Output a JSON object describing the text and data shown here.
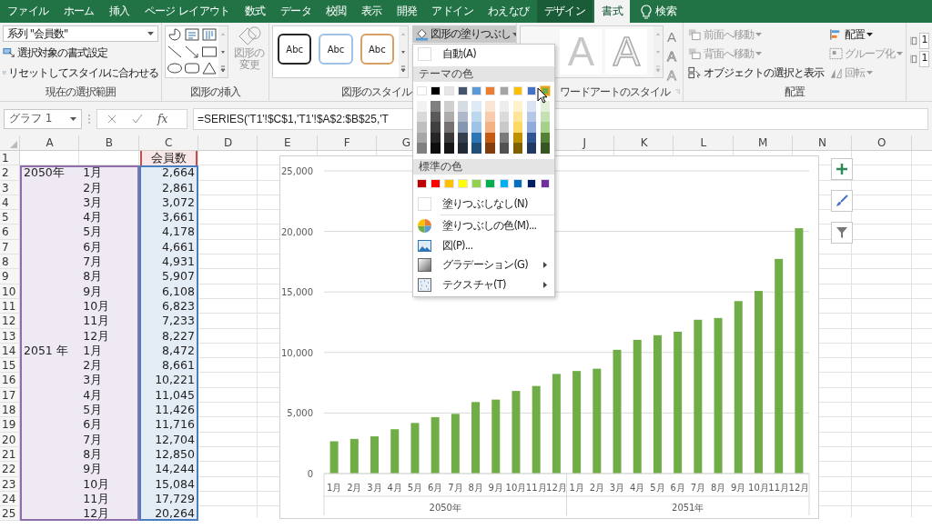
{
  "tabs": [
    {
      "label": "ファイル",
      "selected": false,
      "contextual": false
    },
    {
      "label": "ホーム",
      "selected": false,
      "contextual": false
    },
    {
      "label": "挿入",
      "selected": false,
      "contextual": false
    },
    {
      "label": "ページ レイアウト",
      "selected": false,
      "contextual": false
    },
    {
      "label": "数式",
      "selected": false,
      "contextual": false
    },
    {
      "label": "データ",
      "selected": false,
      "contextual": false
    },
    {
      "label": "校閲",
      "selected": false,
      "contextual": false
    },
    {
      "label": "表示",
      "selected": false,
      "contextual": false
    },
    {
      "label": "開発",
      "selected": false,
      "contextual": false
    },
    {
      "label": "アドイン",
      "selected": false,
      "contextual": false
    },
    {
      "label": "わえなび",
      "selected": false,
      "contextual": false
    },
    {
      "label": "デザイン",
      "selected": false,
      "contextual": true
    },
    {
      "label": "書式",
      "selected": true,
      "contextual": true
    }
  ],
  "tell_me": "検索",
  "ribbon": {
    "current_selection": {
      "label": "現在の選択範囲",
      "element": "系列 \"会員数\"",
      "buttons": [
        {
          "label": "選択対象の書式設定",
          "kind": "format"
        },
        {
          "label": "リセットしてスタイルに合わせる",
          "kind": "reset"
        }
      ]
    },
    "insert_shapes": {
      "label": "図形の挿入",
      "change_shape": {
        "label": "図形の変更",
        "disabled": true
      }
    },
    "shape_styles": {
      "label": "図形のスタイル",
      "presets": [
        {
          "text": "Abc",
          "color": "#262626"
        },
        {
          "text": "Abc",
          "color": "#9dc3e6"
        },
        {
          "text": "Abc",
          "color": "#d9a066"
        }
      ],
      "fill_button": {
        "label": "図形の塗りつぶし",
        "pressed": true
      }
    },
    "wordart_styles": {
      "label": "ワードアートのスタイル",
      "presets": [
        {
          "text": "A",
          "kind": "filled"
        },
        {
          "text": "A",
          "kind": "outline"
        }
      ],
      "buttons": [
        "A",
        "A",
        "A"
      ]
    },
    "arrange": {
      "label": "配置",
      "items": [
        {
          "label": "前面へ移動",
          "kind": "front",
          "disabled": true,
          "dropdown": true
        },
        {
          "label": "背面へ移動",
          "kind": "back",
          "disabled": true,
          "dropdown": true
        },
        {
          "label": "オブジェクトの選択と表示",
          "kind": "pane",
          "disabled": false,
          "dropdown": false
        },
        {
          "label": "配置",
          "kind": "align",
          "disabled": false,
          "dropdown": true
        },
        {
          "label": "グループ化",
          "kind": "group",
          "disabled": true,
          "dropdown": true
        },
        {
          "label": "回転",
          "kind": "rotate",
          "disabled": true,
          "dropdown": true
        }
      ]
    },
    "size": {
      "fields": [
        "1",
        "1"
      ]
    }
  },
  "formula_bar": {
    "name_box": "グラフ 1",
    "function_label": "fx",
    "formula": "=SERIES('T1'!$C$1,'T1'!$A$2:$B$25,'T"
  },
  "sheet": {
    "columns": [
      "A",
      "B",
      "C",
      "D",
      "E",
      "F",
      "G",
      "J",
      "K",
      "L",
      "M",
      "N",
      "O"
    ],
    "rows": [
      {
        "row": "1",
        "c": "会員数"
      },
      {
        "row": "2",
        "a": "2050年",
        "b": "1月",
        "c": "2,664"
      },
      {
        "row": "3",
        "b": "2月",
        "c": "2,861"
      },
      {
        "row": "4",
        "b": "3月",
        "c": "3,072"
      },
      {
        "row": "5",
        "b": "4月",
        "c": "3,661"
      },
      {
        "row": "6",
        "b": "5月",
        "c": "4,178"
      },
      {
        "row": "7",
        "b": "6月",
        "c": "4,661"
      },
      {
        "row": "8",
        "b": "7月",
        "c": "4,931"
      },
      {
        "row": "9",
        "b": "8月",
        "c": "5,907"
      },
      {
        "row": "10",
        "b": "9月",
        "c": "6,108"
      },
      {
        "row": "11",
        "b": "10月",
        "c": "6,823"
      },
      {
        "row": "12",
        "b": "11月",
        "c": "7,233"
      },
      {
        "row": "13",
        "b": "12月",
        "c": "8,227"
      },
      {
        "row": "14",
        "a": "2051 年",
        "b": "1月",
        "c": "8,472"
      },
      {
        "row": "15",
        "b": "2月",
        "c": "8,661"
      },
      {
        "row": "16",
        "b": "3月",
        "c": "10,221"
      },
      {
        "row": "17",
        "b": "4月",
        "c": "11,045"
      },
      {
        "row": "18",
        "b": "5月",
        "c": "11,426"
      },
      {
        "row": "19",
        "b": "6月",
        "c": "11,716"
      },
      {
        "row": "20",
        "b": "7月",
        "c": "12,704"
      },
      {
        "row": "21",
        "b": "8月",
        "c": "12,850"
      },
      {
        "row": "22",
        "b": "9月",
        "c": "14,244"
      },
      {
        "row": "23",
        "b": "10月",
        "c": "15,084"
      },
      {
        "row": "24",
        "b": "11月",
        "c": "17,729"
      },
      {
        "row": "25",
        "b": "12月",
        "c": "20,264"
      }
    ]
  },
  "chart": {
    "chart_data": {
      "type": "bar",
      "categories": [
        "1月",
        "2月",
        "3月",
        "4月",
        "5月",
        "6月",
        "7月",
        "8月",
        "9月",
        "10月",
        "11月",
        "12月",
        "1月",
        "2月",
        "3月",
        "4月",
        "5月",
        "6月",
        "7月",
        "8月",
        "9月",
        "10月",
        "11月",
        "12月"
      ],
      "grid": true,
      "series": [
        {
          "color": "#70ad47",
          "values": [
            2664,
            2861,
            3072,
            3661,
            4178,
            4661,
            4931,
            5907,
            6108,
            6823,
            7233,
            8227,
            8472,
            8661,
            10221,
            11045,
            11426,
            11716,
            12704,
            12850,
            14244,
            15084,
            17729,
            20264
          ]
        }
      ],
      "ylim": [
        0,
        25000
      ],
      "yticks": [
        {
          "value": 0,
          "label": "0"
        },
        {
          "value": 5000,
          "label": "5,000"
        },
        {
          "value": 10000,
          "label": "10,000"
        },
        {
          "value": 15000,
          "label": "15,000"
        },
        {
          "value": 20000,
          "label": "20,000"
        },
        {
          "value": 25000,
          "label": "25,000"
        }
      ]
    },
    "year_groups": [
      "2050年",
      "2051年"
    ]
  },
  "fill_menu": {
    "automatic": "自動(A)",
    "theme_header": "テーマの色",
    "theme_colors": [
      {
        "color": "#ffffff",
        "selected": false,
        "shades": [
          {
            "color": "#f2f2f2"
          },
          {
            "color": "#d9d9d9"
          },
          {
            "color": "#bfbfbf"
          },
          {
            "color": "#a6a6a6"
          },
          {
            "color": "#808080"
          }
        ]
      },
      {
        "color": "#000000",
        "selected": false,
        "shades": [
          {
            "color": "#808080"
          },
          {
            "color": "#595959"
          },
          {
            "color": "#404040"
          },
          {
            "color": "#262626"
          },
          {
            "color": "#0d0d0d"
          }
        ]
      },
      {
        "color": "#e7e6e6",
        "selected": false,
        "shades": [
          {
            "color": "#d0cece"
          },
          {
            "color": "#aeabab"
          },
          {
            "color": "#757171"
          },
          {
            "color": "#3a3838"
          },
          {
            "color": "#171616"
          }
        ]
      },
      {
        "color": "#44546a",
        "selected": false,
        "shades": [
          {
            "color": "#d6dce4"
          },
          {
            "color": "#adb9ca"
          },
          {
            "color": "#8496b0"
          },
          {
            "color": "#333f4f"
          },
          {
            "color": "#222a35"
          }
        ]
      },
      {
        "color": "#5b9bd5",
        "selected": false,
        "shades": [
          {
            "color": "#deebf6"
          },
          {
            "color": "#bdd7ee"
          },
          {
            "color": "#9dc3e6"
          },
          {
            "color": "#2e75b5"
          },
          {
            "color": "#1f4e79"
          }
        ]
      },
      {
        "color": "#ed7d31",
        "selected": false,
        "shades": [
          {
            "color": "#fbe5d5"
          },
          {
            "color": "#f7cbac"
          },
          {
            "color": "#f4b183"
          },
          {
            "color": "#c55a11"
          },
          {
            "color": "#833c0b"
          }
        ]
      },
      {
        "color": "#a5a5a5",
        "selected": false,
        "shades": [
          {
            "color": "#ededed"
          },
          {
            "color": "#dbdbdb"
          },
          {
            "color": "#c9c9c9"
          },
          {
            "color": "#7b7b7b"
          },
          {
            "color": "#525252"
          }
        ]
      },
      {
        "color": "#ffc000",
        "selected": false,
        "shades": [
          {
            "color": "#fff2cc"
          },
          {
            "color": "#fee599"
          },
          {
            "color": "#ffd965"
          },
          {
            "color": "#bf9000"
          },
          {
            "color": "#7f6000"
          }
        ]
      },
      {
        "color": "#4472c4",
        "selected": false,
        "shades": [
          {
            "color": "#dae3f3"
          },
          {
            "color": "#b4c7e7"
          },
          {
            "color": "#8faadc"
          },
          {
            "color": "#2f5496"
          },
          {
            "color": "#1f3864"
          }
        ]
      },
      {
        "color": "#70ad47",
        "selected": true,
        "shades": [
          {
            "color": "#e2efd9"
          },
          {
            "color": "#c5e0b3"
          },
          {
            "color": "#a8d08d"
          },
          {
            "color": "#538135"
          },
          {
            "color": "#375623"
          }
        ]
      }
    ],
    "standard_header": "標準の色",
    "standard_colors": [
      {
        "color": "#c00000"
      },
      {
        "color": "#ff0000"
      },
      {
        "color": "#ffc000"
      },
      {
        "color": "#ffff00"
      },
      {
        "color": "#92d050"
      },
      {
        "color": "#00b050"
      },
      {
        "color": "#00b0f0"
      },
      {
        "color": "#0070c0"
      },
      {
        "color": "#002060"
      },
      {
        "color": "#7030a0"
      }
    ],
    "commands": [
      {
        "label": "塗りつぶしなし(N)",
        "kind": "none",
        "submenu": false
      },
      {
        "label": "塗りつぶしの色(M)...",
        "kind": "more",
        "submenu": false
      },
      {
        "label": "図(P)...",
        "kind": "picture",
        "submenu": false
      },
      {
        "label": "グラデーション(G)",
        "kind": "gradient",
        "submenu": true
      },
      {
        "label": "テクスチャ(T)",
        "kind": "texture",
        "submenu": true
      }
    ]
  }
}
